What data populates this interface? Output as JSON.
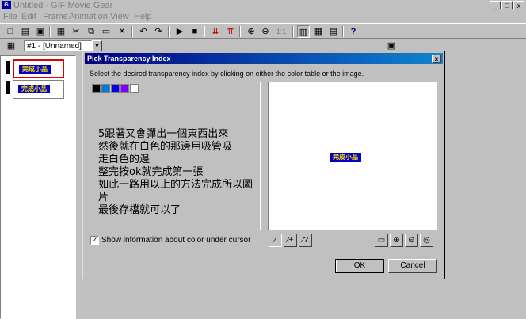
{
  "window": {
    "title": "Untitled - GIF Movie Gear",
    "min_label": "_",
    "max_label": "□",
    "close_label": "x"
  },
  "menu": {
    "items": [
      "File",
      "Edit",
      "Frame",
      "Animation",
      "View",
      "Help"
    ]
  },
  "toolbar": {
    "buttons": [
      {
        "glyph": "□",
        "icon": "new-file-icon"
      },
      {
        "glyph": "▤",
        "icon": "open-icon"
      },
      {
        "glyph": "▣",
        "icon": "save-icon"
      },
      {
        "glyph": "▦",
        "icon": "image-icon"
      },
      {
        "glyph": "✂",
        "icon": "cut-icon"
      },
      {
        "glyph": "⧉",
        "icon": "copy-icon"
      },
      {
        "glyph": "▭",
        "icon": "paste-icon"
      },
      {
        "glyph": "✕",
        "icon": "delete-icon"
      },
      {
        "glyph": "↶",
        "icon": "undo-icon"
      },
      {
        "glyph": "↷",
        "icon": "redo-icon"
      },
      {
        "glyph": "▶",
        "icon": "play-icon"
      },
      {
        "glyph": "■",
        "icon": "stop-icon"
      },
      {
        "glyph": "⇊",
        "icon": "insert-frame-icon"
      },
      {
        "glyph": "⇈",
        "icon": "remove-frame-icon"
      },
      {
        "glyph": "⊕",
        "icon": "zoom-in-icon"
      },
      {
        "glyph": "⊖",
        "icon": "zoom-out-icon"
      },
      {
        "glyph": "1:1",
        "icon": "actual-size-icon"
      },
      {
        "glyph": "▥",
        "icon": "frame-view-icon"
      },
      {
        "glyph": "▦",
        "icon": "grid-view-icon"
      },
      {
        "glyph": "▤",
        "icon": "list-view-icon"
      },
      {
        "glyph": "?",
        "icon": "help-icon"
      }
    ]
  },
  "toolbar2": {
    "frame_combo_value": "#1 - [Unnamed]"
  },
  "frames": [
    {
      "label": "完成小品"
    },
    {
      "label": "完成小品"
    }
  ],
  "dialog": {
    "title": "Pick Transparency Index",
    "close_label": "x",
    "instruction": "Select the desired transparency index by clicking on either the color table or the image.",
    "swatch_colors": [
      "#000000",
      "#0078d8",
      "#0000e0",
      "#8000ff",
      "#ffffff"
    ],
    "annotation_lines": [
      "5跟著又會彈出一個東西出來",
      "然後就在白色的那邊用吸管吸",
      "走白色的邊",
      "整完按ok就完成第一張",
      "如此一路用以上的方法完成所以圖片",
      "最後存檔就可以了"
    ],
    "preview_label": "完成小品",
    "checkbox_label": "Show information about color under cursor",
    "checkbox_mark": "✓",
    "picker_tools": [
      {
        "glyph": "⁄",
        "icon": "eyedropper-icon"
      },
      {
        "glyph": "⁄+",
        "icon": "eyedropper-plus-icon"
      },
      {
        "glyph": "⁄?",
        "icon": "eyedropper-query-icon"
      }
    ],
    "view_tools": [
      {
        "glyph": "▭",
        "icon": "monitor-icon"
      },
      {
        "glyph": "⊕",
        "icon": "zoom-in-icon"
      },
      {
        "glyph": "⊖",
        "icon": "zoom-out-icon"
      },
      {
        "glyph": "◎",
        "icon": "zoom-fit-icon"
      }
    ],
    "ok_label": "OK",
    "cancel_label": "Cancel"
  }
}
